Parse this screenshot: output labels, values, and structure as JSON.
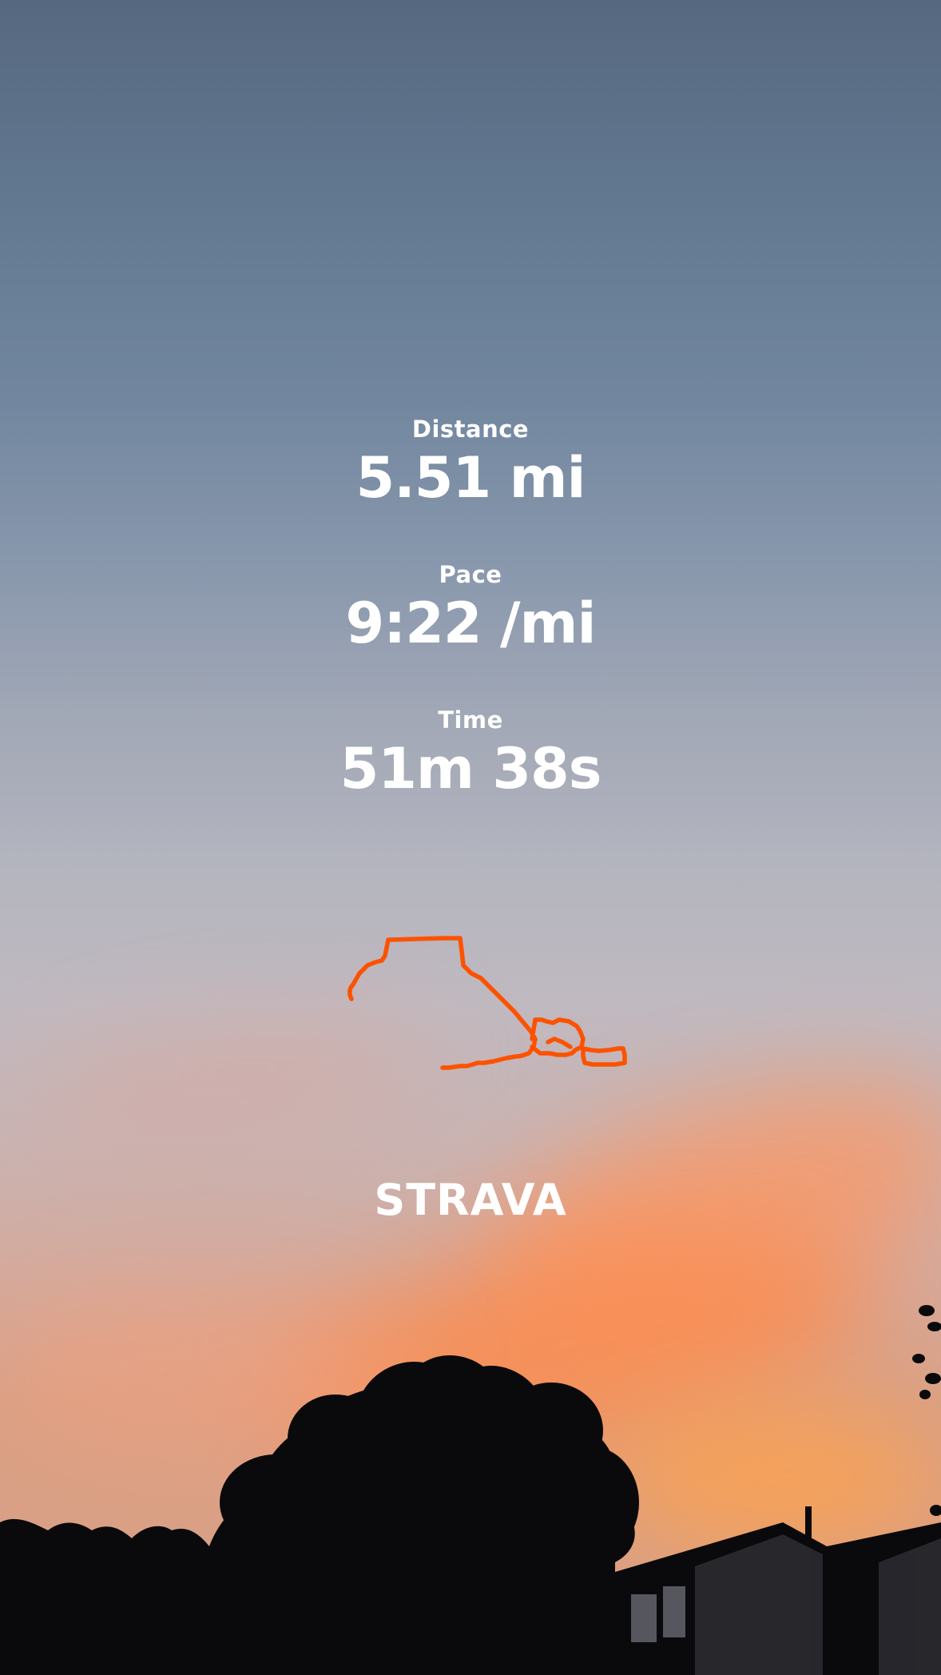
{
  "stats": [
    {
      "label": "Distance",
      "value": "5.51 mi"
    },
    {
      "label": "Pace",
      "value": "9:22 /mi"
    },
    {
      "label": "Time",
      "value": "51m 38s"
    }
  ],
  "brand": {
    "logo_text": "STRAVA"
  },
  "colors": {
    "text": "#ffffff",
    "route": "#fc5200",
    "sky_top": "#56687f",
    "sunset": "#ff8a4a",
    "silhouette": "#0a0a0c"
  }
}
